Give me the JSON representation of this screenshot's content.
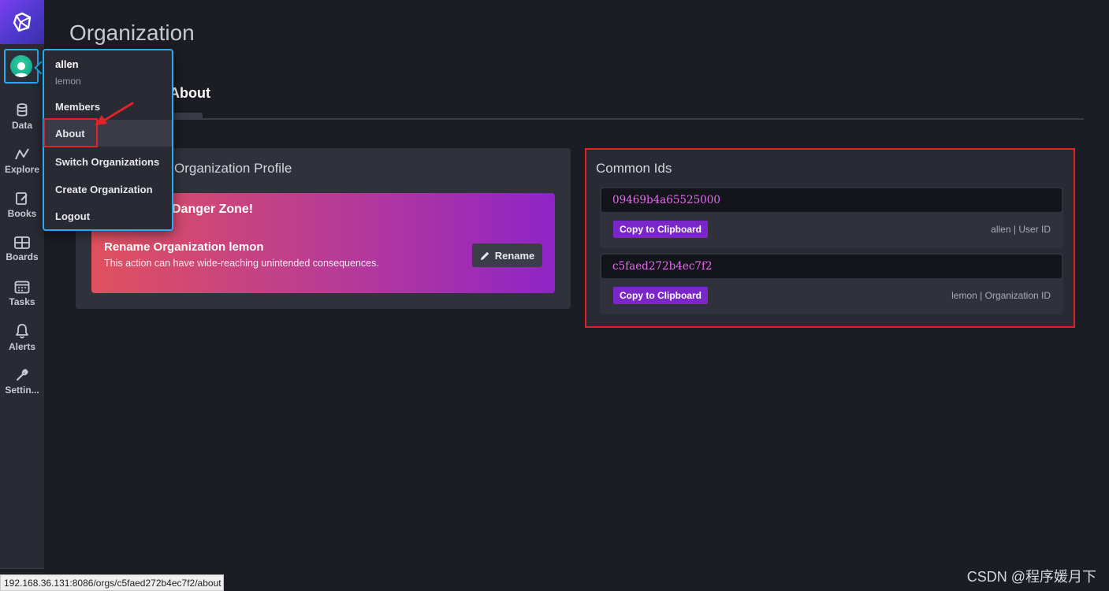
{
  "page": {
    "title": "Organization",
    "tab_label": "About"
  },
  "sidebar": {
    "items": [
      {
        "label": "Data",
        "icon": "database-icon"
      },
      {
        "label": "Explore",
        "icon": "graph-icon"
      },
      {
        "label": "Books",
        "icon": "notebook-icon"
      },
      {
        "label": "Boards",
        "icon": "dashboard-icon"
      },
      {
        "label": "Tasks",
        "icon": "calendar-icon"
      },
      {
        "label": "Alerts",
        "icon": "bell-icon"
      },
      {
        "label": "Settin...",
        "icon": "wrench-icon"
      }
    ]
  },
  "user_menu": {
    "username": "allen",
    "org": "lemon",
    "items": [
      "Members",
      "About",
      "Switch Organizations",
      "Create Organization",
      "Logout"
    ],
    "active": "About"
  },
  "profile": {
    "title": "Organization Profile",
    "danger_heading": "Danger Zone!",
    "rename_title": "Rename Organization lemon",
    "rename_desc": "This action can have wide-reaching unintended consequences.",
    "rename_button": "Rename"
  },
  "common_ids": {
    "title": "Common Ids",
    "entries": [
      {
        "id": "09469b4a65525000",
        "copy_label": "Copy to Clipboard",
        "owner": "allen",
        "kind": "User ID"
      },
      {
        "id": "c5faed272b4ec7f2",
        "copy_label": "Copy to Clipboard",
        "owner": "lemon",
        "kind": "Organization ID"
      }
    ]
  },
  "statusbar": {
    "url": "192.168.36.131:8086/orgs/c5faed272b4ec7f2/about"
  },
  "watermark": "CSDN @程序媛月下",
  "colors": {
    "accent": "#22adf6",
    "highlight": "#e02424",
    "id_text": "#e76cf2",
    "copy_button": "#7a26c9"
  }
}
